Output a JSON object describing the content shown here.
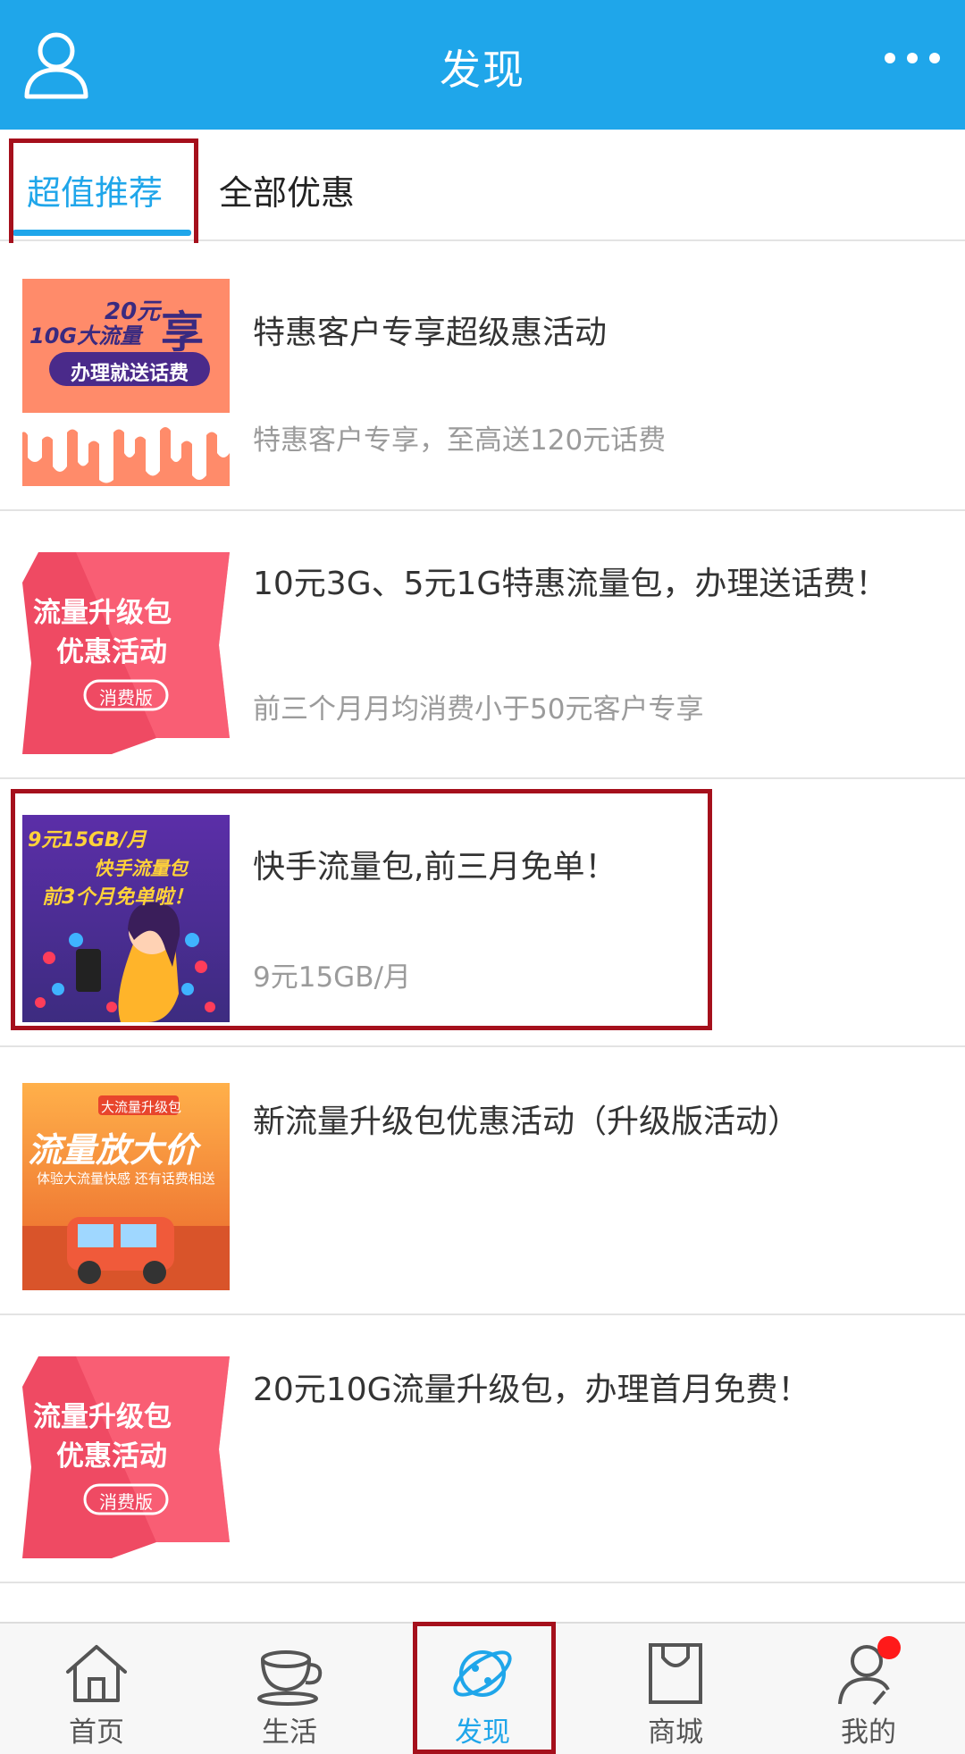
{
  "header": {
    "title": "发现",
    "user_icon": "user-profile-icon",
    "more_icon": "more-dots-icon",
    "bg_color": "#1fa6ea"
  },
  "tabs": [
    {
      "label": "超值推荐",
      "active": true
    },
    {
      "label": "全部优惠",
      "active": false
    }
  ],
  "items": [
    {
      "title": "特惠客户专享超级惠活动",
      "subtitle": "特惠客户专享，至高送120元话费",
      "thumb": {
        "line1": "20元",
        "line2": "10G大流量",
        "big": "享",
        "badge": "办理就送话费"
      }
    },
    {
      "title": "10元3G、5元1G特惠流量包，办理送话费！",
      "subtitle": "前三个月月均消费小于50元客户专享",
      "thumb": {
        "line1": "流量升级包",
        "line2": "优惠活动",
        "badge": "消费版"
      }
    },
    {
      "title": "快手流量包,前三月免单！",
      "subtitle": "9元15GB/月",
      "thumb": {
        "line1": "9元15GB/月",
        "line2": "快手流量包",
        "line3": "前3个月免单啦！"
      }
    },
    {
      "title": "新流量升级包优惠活动（升级版活动）",
      "subtitle": "",
      "thumb": {
        "top": "大流量升级包",
        "line1": "流量放大价",
        "line2": "体验大流量快感 还有话费相送"
      }
    },
    {
      "title": "20元10G流量升级包，办理首月免费！",
      "subtitle": "",
      "thumb": {
        "line1": "流量升级包",
        "line2": "优惠活动",
        "badge": "消费版"
      }
    }
  ],
  "bottom_nav": [
    {
      "label": "首页",
      "icon": "home-icon",
      "active": false
    },
    {
      "label": "生活",
      "icon": "coffee-cup-icon",
      "active": false
    },
    {
      "label": "发现",
      "icon": "planet-icon",
      "active": true
    },
    {
      "label": "商城",
      "icon": "shopping-bag-icon",
      "active": false
    },
    {
      "label": "我的",
      "icon": "user-icon",
      "active": false,
      "badge_dot": true
    }
  ],
  "colors": {
    "accent": "#1fa6ea",
    "highlight_box": "#a5101c",
    "notification_dot": "#ff1a1a"
  }
}
